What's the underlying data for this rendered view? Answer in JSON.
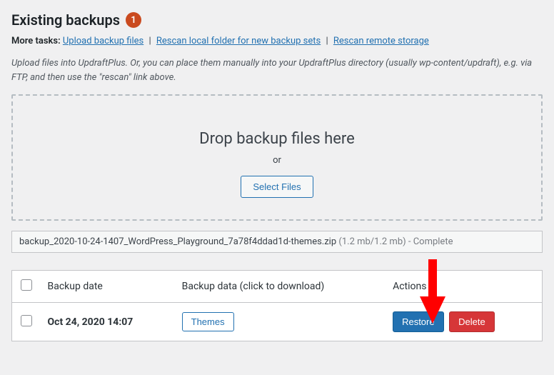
{
  "heading": {
    "title": "Existing backups",
    "count": "1"
  },
  "more_tasks": {
    "label": "More tasks:",
    "upload": "Upload backup files",
    "rescan_local": "Rescan local folder for new backup sets",
    "rescan_remote": "Rescan remote storage",
    "sep": "|"
  },
  "helper_text": "Upload files into UpdraftPlus. Or, you can place them manually into your UpdraftPlus directory (usually wp-content/updraft), e.g. via FTP, and then use the \"rescan\" link above.",
  "dropzone": {
    "title": "Drop backup files here",
    "or": "or",
    "select_files": "Select Files"
  },
  "status": {
    "filename": "backup_2020-10-24-1407_WordPress_Playground_7a78f4ddad1d-themes.zip",
    "meta": " (1.2 mb/1.2 mb) - Complete"
  },
  "table": {
    "headers": {
      "date": "Backup date",
      "data": "Backup data (click to download)",
      "actions": "Actions"
    },
    "rows": [
      {
        "date": "Oct 24, 2020 14:07",
        "data": "Themes",
        "restore": "Restore",
        "delete": "Delete"
      }
    ]
  }
}
